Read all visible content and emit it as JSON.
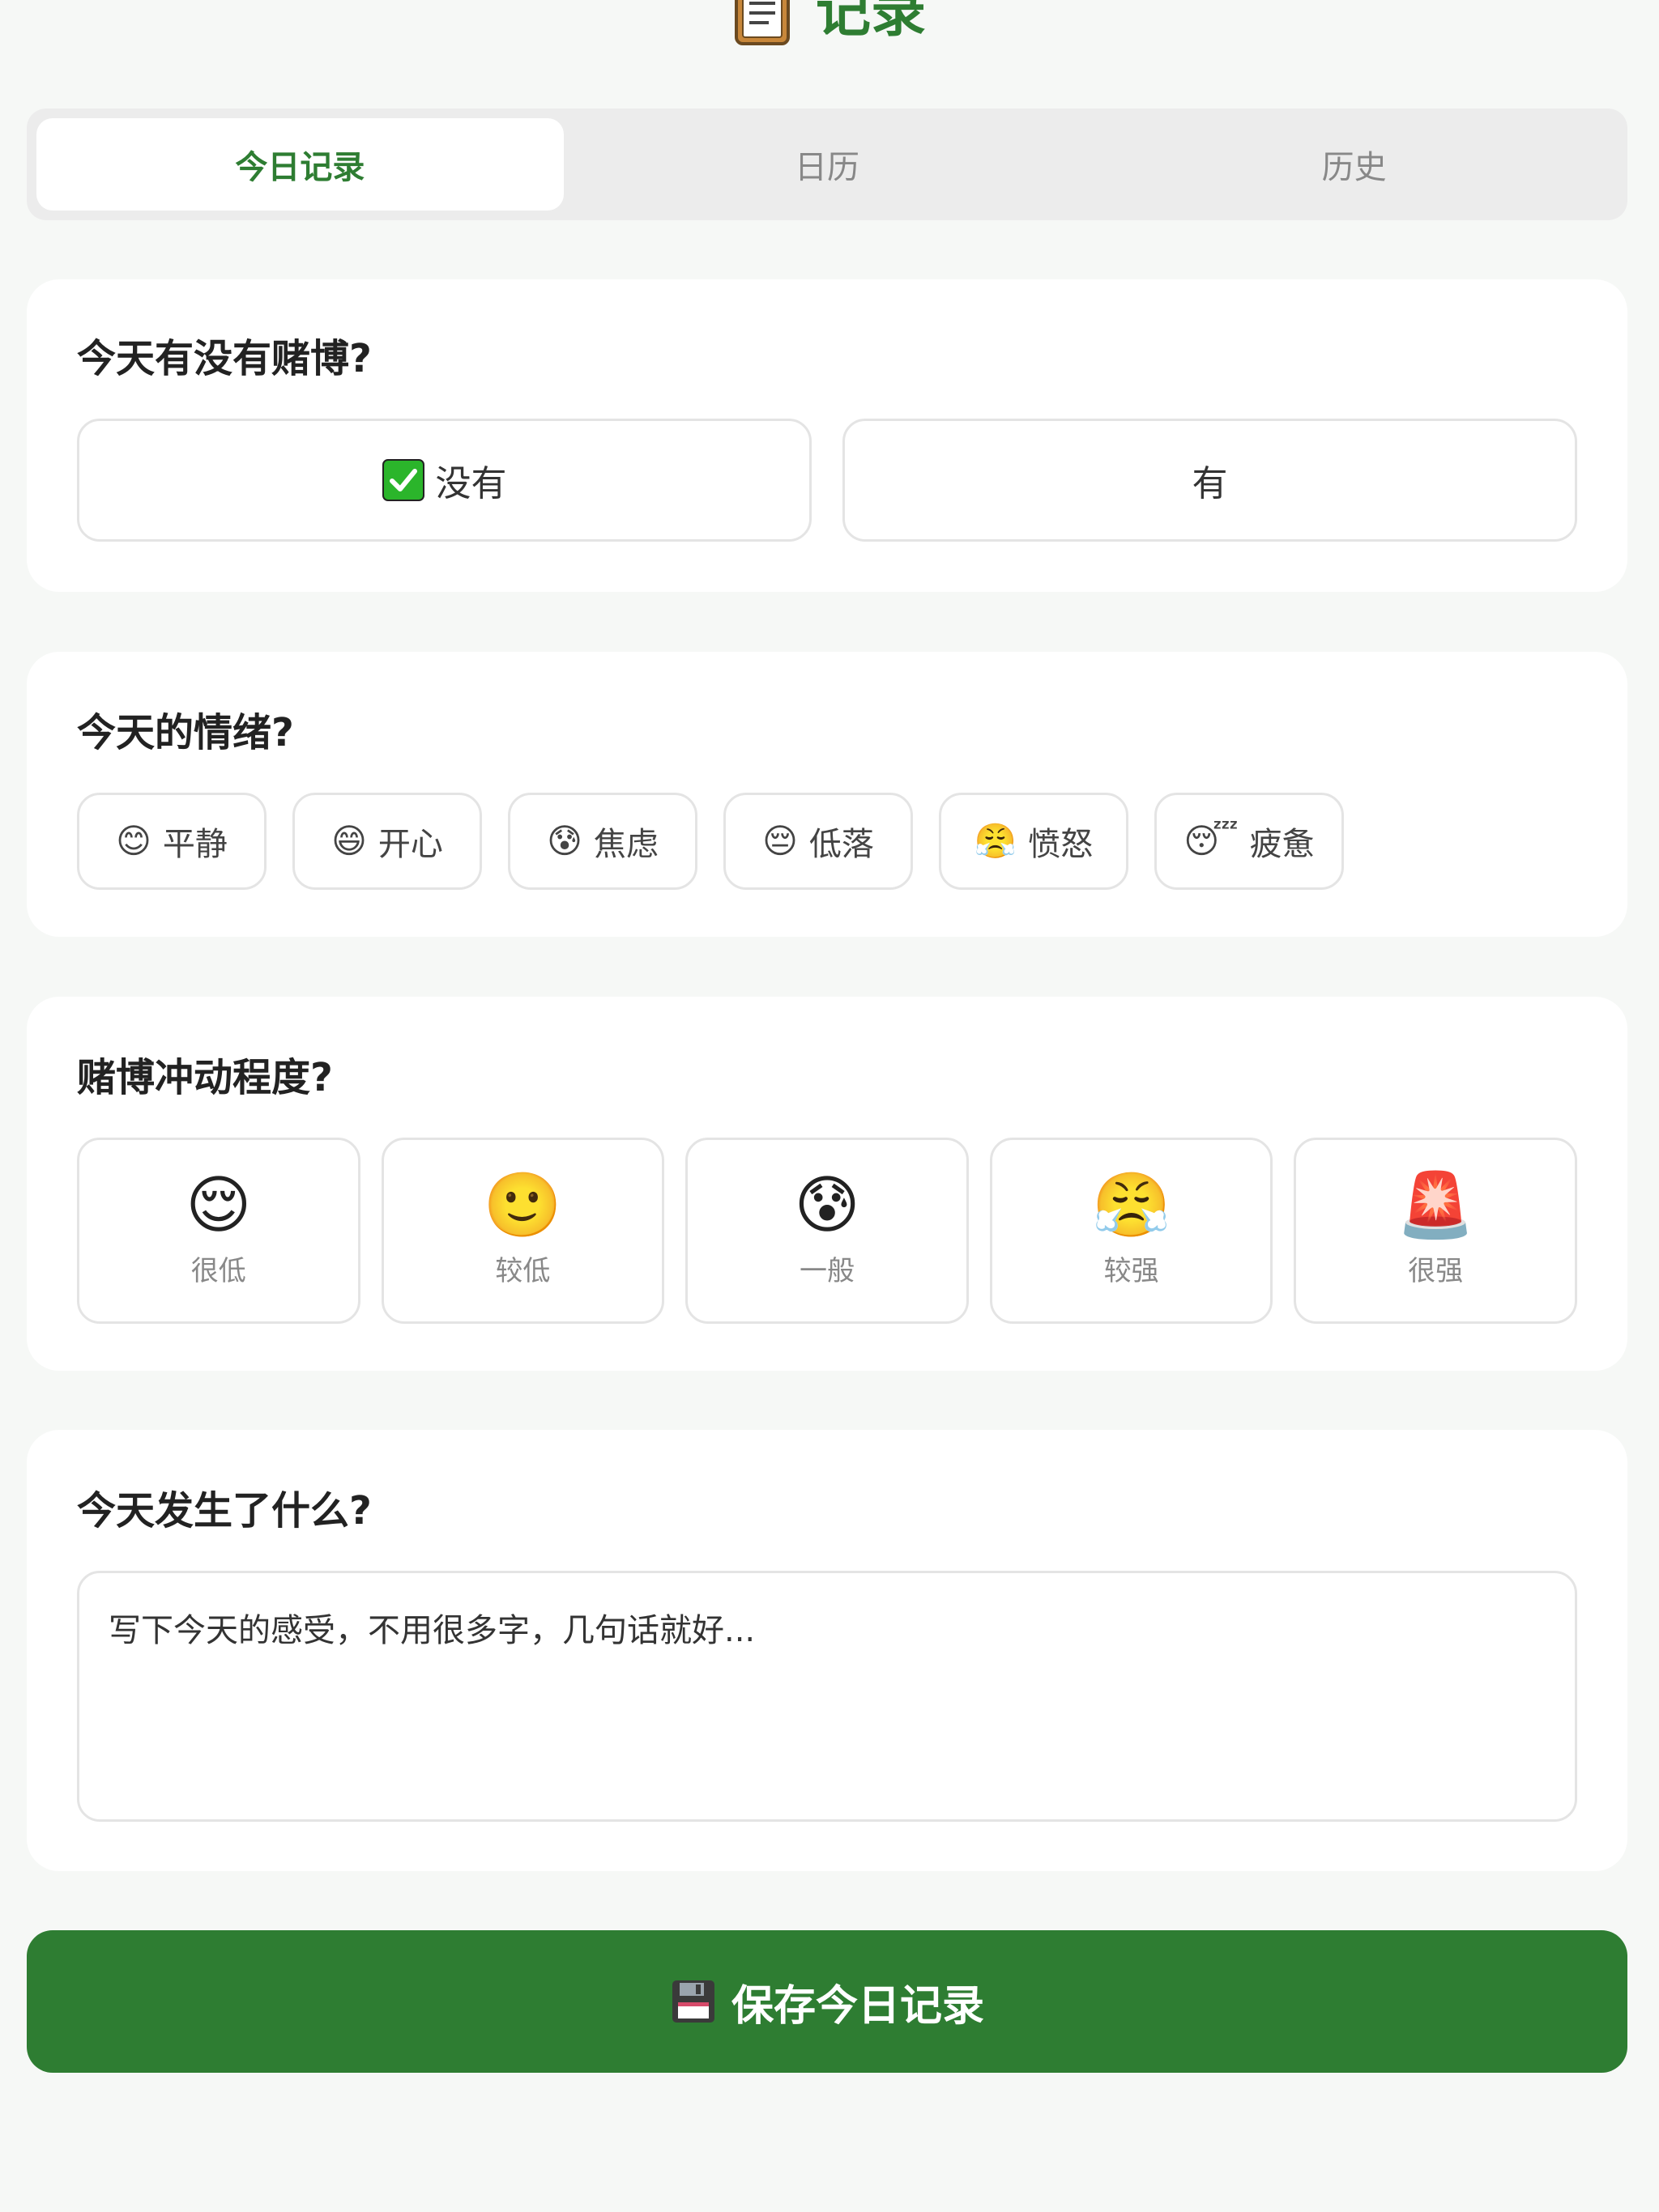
{
  "header": {
    "title": "记录",
    "icon": "document-icon"
  },
  "tabs": [
    {
      "label": "今日记录",
      "active": true
    },
    {
      "label": "日历",
      "active": false
    },
    {
      "label": "历史",
      "active": false
    }
  ],
  "gamble": {
    "question": "今天有没有赌博?",
    "options": [
      {
        "label": "没有",
        "icon": "check-mark-icon",
        "selected": false
      },
      {
        "label": "有",
        "selected": false
      }
    ]
  },
  "mood": {
    "question": "今天的情绪?",
    "options": [
      {
        "emoji": "😊",
        "label": "平静"
      },
      {
        "emoji": "😄",
        "label": "开心"
      },
      {
        "emoji": "😰",
        "label": "焦虑"
      },
      {
        "emoji": "😔",
        "label": "低落"
      },
      {
        "emoji": "😤",
        "label": "愤怒"
      },
      {
        "emoji": "😴",
        "label": "疲惫"
      }
    ]
  },
  "urge": {
    "question": "赌博冲动程度?",
    "levels": [
      {
        "emoji": "😌",
        "label": "很低"
      },
      {
        "emoji": "🙂",
        "label": "较低"
      },
      {
        "emoji": "😰",
        "label": "一般"
      },
      {
        "emoji": "😤",
        "label": "较强"
      },
      {
        "emoji": "🚨",
        "label": "很强"
      }
    ]
  },
  "journal": {
    "question": "今天发生了什么?",
    "placeholder": "写下今天的感受，不用很多字，几句话就好...",
    "value": ""
  },
  "save": {
    "label": "保存今日记录",
    "icon": "floppy-disk-icon"
  },
  "colors": {
    "accent": "#2e7d32",
    "background": "#f6f8f6",
    "card": "#ffffff",
    "tab_track": "#ececec",
    "border": "#e4e4e4"
  }
}
